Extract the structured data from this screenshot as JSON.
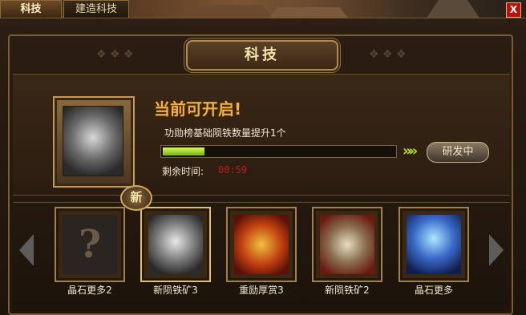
{
  "tabs": [
    {
      "label": "科技",
      "active": true
    },
    {
      "label": "建造科技",
      "active": false
    }
  ],
  "close_label": "X",
  "panel_title": "科技",
  "current": {
    "headline": "当前可开启!",
    "description": "功勋榜基础陨铁数量提升1个",
    "progress": 0.18,
    "arrows": "»»",
    "research_label": "研发中",
    "time_label": "剩余时间:",
    "time_value": "00:59",
    "icon": "iron-ore-icon"
  },
  "new_badge": "新",
  "cards": [
    {
      "label": "晶石更多2",
      "icon": "unknown-question-icon",
      "glyph": "?"
    },
    {
      "label": "新陨铁矿3",
      "icon": "iron-ore-icon",
      "glyph": ""
    },
    {
      "label": "重励厚赏3",
      "icon": "treasure-chest-icon",
      "glyph": ""
    },
    {
      "label": "新陨铁矿2",
      "icon": "iron-ore-icon",
      "glyph": ""
    },
    {
      "label": "晶石更多",
      "icon": "crystal-chest-icon",
      "glyph": ""
    }
  ],
  "colors": {
    "headline": "#f0b040",
    "timer": "#c21a14",
    "progress_fill": "#a8d82a"
  }
}
